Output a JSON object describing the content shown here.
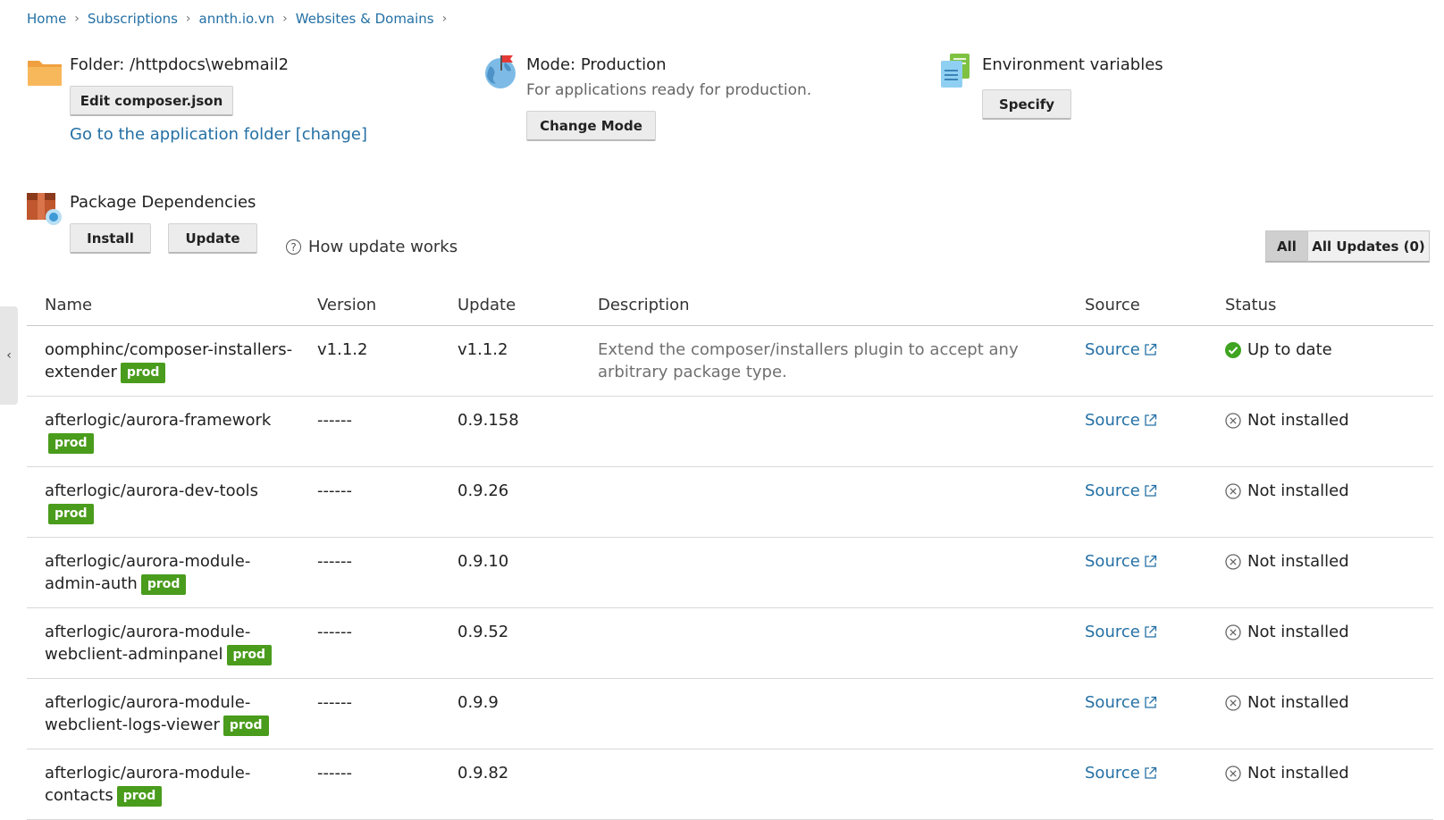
{
  "breadcrumb": [
    "Home",
    "Subscriptions",
    "annth.io.vn",
    "Websites & Domains"
  ],
  "folder": {
    "title": "Folder: /httpdocs\\webmail2",
    "edit_button": "Edit composer.json",
    "go_link": "Go to the application folder",
    "change_link": "[change]"
  },
  "mode": {
    "title": "Mode: Production",
    "subtitle": "For applications ready for production.",
    "change_button": "Change Mode"
  },
  "env": {
    "title": "Environment variables",
    "specify_button": "Specify"
  },
  "deps": {
    "title": "Package Dependencies",
    "install_button": "Install",
    "update_button": "Update",
    "help_link": "How update works",
    "filter_all": "All",
    "filter_updates": "All Updates (0)"
  },
  "table": {
    "headers": [
      "Name",
      "Version",
      "Update",
      "Description",
      "Source",
      "Status"
    ],
    "rows": [
      {
        "name": "oomphinc/composer-installers-extender",
        "badge": "prod",
        "version": "v1.1.2",
        "update": "v1.1.2",
        "description": "Extend the composer/installers plugin to accept any arbitrary package type.",
        "source": "Source",
        "status": "Up to date",
        "status_type": "ok"
      },
      {
        "name": "afterlogic/aurora-framework",
        "badge": "prod",
        "version": "------",
        "update": "0.9.158",
        "description": "",
        "source": "Source",
        "status": "Not installed",
        "status_type": "none"
      },
      {
        "name": "afterlogic/aurora-dev-tools",
        "badge": "prod",
        "version": "------",
        "update": "0.9.26",
        "description": "",
        "source": "Source",
        "status": "Not installed",
        "status_type": "none"
      },
      {
        "name": "afterlogic/aurora-module-admin-auth",
        "badge": "prod",
        "version": "------",
        "update": "0.9.10",
        "description": "",
        "source": "Source",
        "status": "Not installed",
        "status_type": "none"
      },
      {
        "name": "afterlogic/aurora-module-webclient-adminpanel",
        "badge": "prod",
        "version": "------",
        "update": "0.9.52",
        "description": "",
        "source": "Source",
        "status": "Not installed",
        "status_type": "none"
      },
      {
        "name": "afterlogic/aurora-module-webclient-logs-viewer",
        "badge": "prod",
        "version": "------",
        "update": "0.9.9",
        "description": "",
        "source": "Source",
        "status": "Not installed",
        "status_type": "none"
      },
      {
        "name": "afterlogic/aurora-module-contacts",
        "badge": "prod",
        "version": "------",
        "update": "0.9.82",
        "description": "",
        "source": "Source",
        "status": "Not installed",
        "status_type": "none"
      }
    ]
  },
  "colors": {
    "link": "#2470a5",
    "badge": "#4a9c1c",
    "ok": "#3fa41f"
  }
}
